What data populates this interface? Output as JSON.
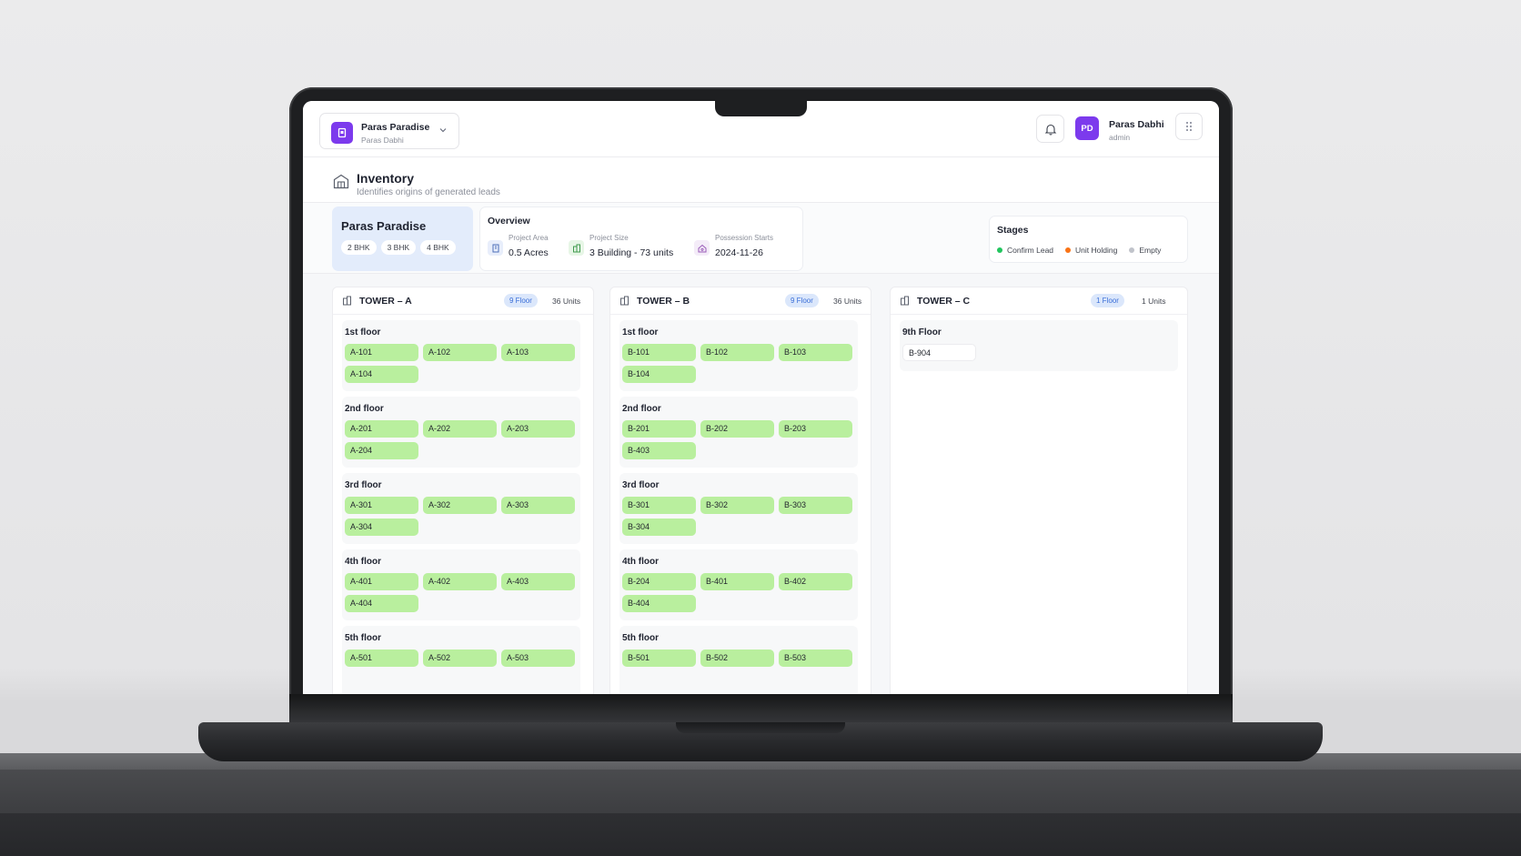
{
  "header": {
    "project_name": "Paras Paradise",
    "project_owner": "Paras Dabhi",
    "user_initials": "PD",
    "user_name": "Paras Dabhi",
    "user_role": "admin"
  },
  "page": {
    "title": "Inventory",
    "subtitle": "Identifies origins of generated leads"
  },
  "project_card": {
    "title": "Paras Paradise",
    "tags": [
      "2 BHK",
      "3 BHK",
      "4 BHK"
    ]
  },
  "overview": {
    "title": "Overview",
    "items": [
      {
        "label": "Project Area",
        "value": "0.5 Acres",
        "icon": "building-icon"
      },
      {
        "label": "Project Size",
        "value": "3 Building - 73 units",
        "icon": "office-building-icon"
      },
      {
        "label": "Possession Starts",
        "value": "2024-11-26",
        "icon": "house-key-icon"
      }
    ]
  },
  "stages": {
    "title": "Stages",
    "items": [
      {
        "label": "Confirm Lead",
        "color": "#22c55e"
      },
      {
        "label": "Unit Holding",
        "color": "#f97316"
      },
      {
        "label": "Empty",
        "color": "#c0c3ca"
      }
    ]
  },
  "towers": [
    {
      "name": "TOWER – A",
      "floors_badge": "9 Floor",
      "units": "36 Units",
      "floors": [
        {
          "name": "1st floor",
          "units": [
            "A-101",
            "A-102",
            "A-103",
            "A-104"
          ]
        },
        {
          "name": "2nd floor",
          "units": [
            "A-201",
            "A-202",
            "A-203",
            "A-204"
          ]
        },
        {
          "name": "3rd floor",
          "units": [
            "A-301",
            "A-302",
            "A-303",
            "A-304"
          ]
        },
        {
          "name": "4th floor",
          "units": [
            "A-401",
            "A-402",
            "A-403",
            "A-404"
          ]
        },
        {
          "name": "5th floor",
          "units": [
            "A-501",
            "A-502",
            "A-503"
          ]
        }
      ]
    },
    {
      "name": "TOWER – B",
      "floors_badge": "9 Floor",
      "units": "36 Units",
      "floors": [
        {
          "name": "1st floor",
          "units": [
            "B-101",
            "B-102",
            "B-103",
            "B-104"
          ]
        },
        {
          "name": "2nd floor",
          "units": [
            "B-201",
            "B-202",
            "B-203",
            "B-403"
          ]
        },
        {
          "name": "3rd floor",
          "units": [
            "B-301",
            "B-302",
            "B-303",
            "B-304"
          ]
        },
        {
          "name": "4th floor",
          "units": [
            "B-204",
            "B-401",
            "B-402",
            "B-404"
          ]
        },
        {
          "name": "5th floor",
          "units": [
            "B-501",
            "B-502",
            "B-503"
          ]
        }
      ]
    },
    {
      "name": "TOWER – C",
      "floors_badge": "1 Floor",
      "units": "1 Units",
      "floors": [
        {
          "name": "9th Floor",
          "units": [
            "B-904"
          ],
          "state": "empty"
        }
      ]
    }
  ],
  "colors": {
    "accent": "#7c3aed",
    "confirm_unit": "#b9ef9e",
    "project_card_bg": "#e3ecfb"
  }
}
